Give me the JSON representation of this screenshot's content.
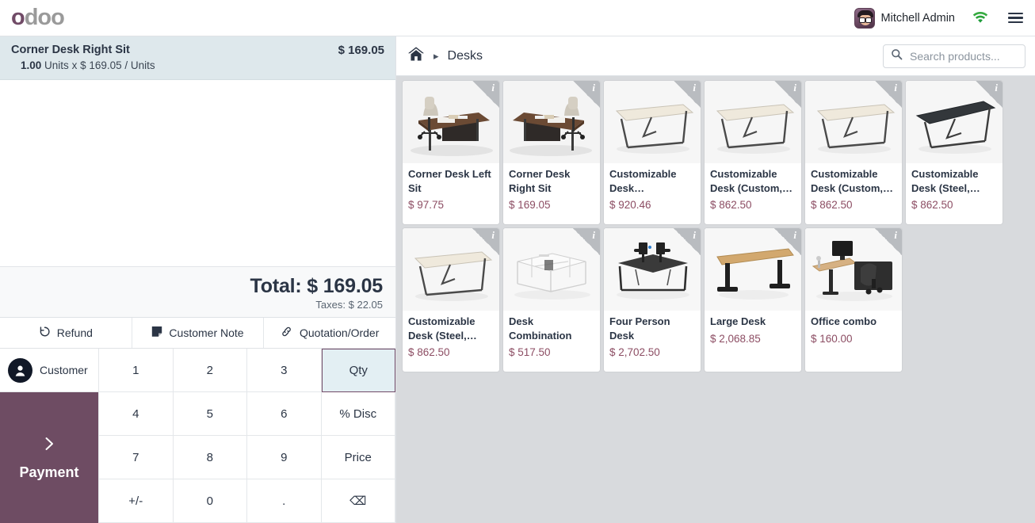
{
  "brand": {
    "logo_first": "o",
    "logo_rest": "doo",
    "accent": "#714B67"
  },
  "topbar": {
    "username": "Mitchell Admin",
    "avatar_name": "user-avatar",
    "wifi_icon": "wifi-icon",
    "wifi_color": "#1e9c3a",
    "menu_icon": "hamburger-menu-icon"
  },
  "order": {
    "lines": [
      {
        "name": "Corner Desk Right Sit",
        "qty": "1.00",
        "unit": "Units",
        "x": "x",
        "unit_price": "$ 169.05",
        "per": "/ Units",
        "line_total": "$ 169.05",
        "selected": true
      }
    ],
    "total_label": "Total:",
    "total_value": "$ 169.05",
    "taxes_label": "Taxes:",
    "taxes_value": "$ 22.05"
  },
  "actions": [
    {
      "label": "Refund",
      "icon": "refund-arrow-icon"
    },
    {
      "label": "Customer Note",
      "icon": "note-icon"
    },
    {
      "label": "Quotation/Order",
      "icon": "link-icon"
    }
  ],
  "pad": {
    "customer_label": "Customer",
    "customer_icon": "person-icon",
    "payment_label": "Payment",
    "payment_icon": "chevron-right-icon",
    "payment_color": "#6e4c63",
    "keys": [
      {
        "label": "1",
        "name": "numpad-1",
        "selected": false
      },
      {
        "label": "2",
        "name": "numpad-2",
        "selected": false
      },
      {
        "label": "3",
        "name": "numpad-3",
        "selected": false
      },
      {
        "label": "Qty",
        "name": "numpad-qty",
        "selected": true
      },
      {
        "label": "4",
        "name": "numpad-4",
        "selected": false
      },
      {
        "label": "5",
        "name": "numpad-5",
        "selected": false
      },
      {
        "label": "6",
        "name": "numpad-6",
        "selected": false
      },
      {
        "label": "% Disc",
        "name": "numpad-discount",
        "selected": false
      },
      {
        "label": "7",
        "name": "numpad-7",
        "selected": false
      },
      {
        "label": "8",
        "name": "numpad-8",
        "selected": false
      },
      {
        "label": "9",
        "name": "numpad-9",
        "selected": false
      },
      {
        "label": "Price",
        "name": "numpad-price",
        "selected": false
      },
      {
        "label": "+/-",
        "name": "numpad-plusminus",
        "selected": false
      },
      {
        "label": "0",
        "name": "numpad-0",
        "selected": false
      },
      {
        "label": ".",
        "name": "numpad-decimal",
        "selected": false
      },
      {
        "label": "⌫",
        "name": "numpad-backspace",
        "selected": false
      }
    ]
  },
  "products_header": {
    "home_icon": "home-icon",
    "separator": "▸",
    "category": "Desks",
    "search_icon": "search-icon",
    "search_value": "",
    "search_placeholder": "Search products..."
  },
  "products": [
    {
      "name": "Corner Desk Left Sit",
      "price": "$ 97.75",
      "art": "corner-desk-left",
      "info": "i"
    },
    {
      "name": "Corner Desk Right Sit",
      "price": "$ 169.05",
      "art": "corner-desk-right",
      "info": "i"
    },
    {
      "name": "Customizable Desk (Aluminium, White)",
      "price": "$ 920.46",
      "art": "plain-desk",
      "info": "i"
    },
    {
      "name": "Customizable Desk (Custom, White)",
      "price": "$ 862.50",
      "art": "plain-desk",
      "info": "i"
    },
    {
      "name": "Customizable Desk (Custom, Black)",
      "price": "$ 862.50",
      "art": "plain-desk",
      "info": "i"
    },
    {
      "name": "Customizable Desk (Steel, Black)",
      "price": "$ 862.50",
      "art": "dark-desk",
      "info": "i"
    },
    {
      "name": "Customizable Desk (Steel, White)",
      "price": "$ 862.50",
      "art": "plain-desk",
      "info": "i"
    },
    {
      "name": "Desk Combination",
      "price": "$ 517.50",
      "art": "desk-combination",
      "info": "i"
    },
    {
      "name": "Four Person Desk",
      "price": "$ 2,702.50",
      "art": "four-person-desk",
      "info": "i"
    },
    {
      "name": "Large Desk",
      "price": "$ 2,068.85",
      "art": "large-desk",
      "info": "i"
    },
    {
      "name": "Office combo",
      "price": "$ 160.00",
      "art": "office-combo",
      "info": "i"
    }
  ]
}
